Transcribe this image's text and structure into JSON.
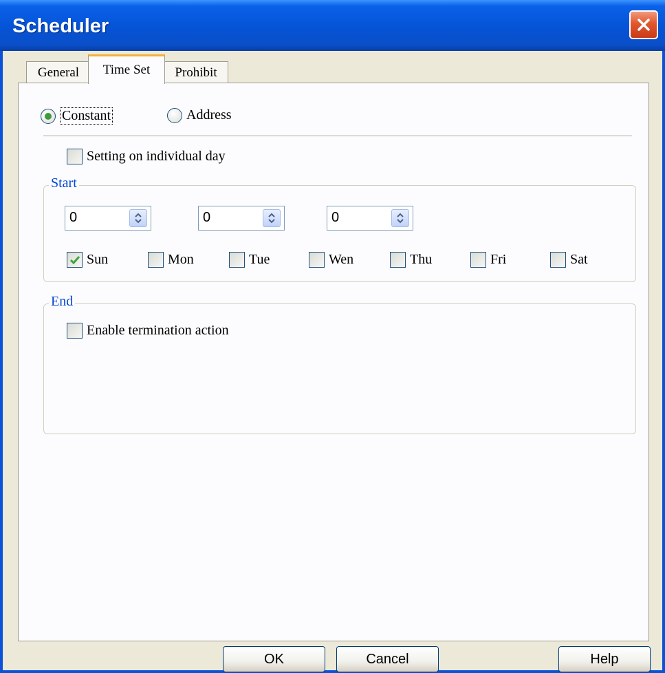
{
  "window": {
    "title": "Scheduler"
  },
  "tabs": [
    {
      "label": "General"
    },
    {
      "label": "Time Set"
    },
    {
      "label": "Prohibit"
    }
  ],
  "mode": {
    "constant_label": "Constant",
    "address_label": "Address",
    "selected": "Constant"
  },
  "individual_day": {
    "label": "Setting on individual day",
    "checked": false
  },
  "start": {
    "group_label": "Start",
    "spinners": [
      {
        "value": "0"
      },
      {
        "value": "0"
      },
      {
        "value": "0"
      }
    ],
    "days": [
      {
        "label": "Sun",
        "checked": true
      },
      {
        "label": "Mon",
        "checked": false
      },
      {
        "label": "Tue",
        "checked": false
      },
      {
        "label": "Wen",
        "checked": false
      },
      {
        "label": "Thu",
        "checked": false
      },
      {
        "label": "Fri",
        "checked": false
      },
      {
        "label": "Sat",
        "checked": false
      }
    ]
  },
  "end": {
    "group_label": "End",
    "termination": {
      "label": "Enable termination action",
      "checked": false
    }
  },
  "buttons": {
    "ok": "OK",
    "cancel": "Cancel",
    "help": "Help"
  },
  "colors": {
    "title_bar": "#0553d6",
    "group_label": "#0046d5",
    "check_mark": "#3da43d",
    "radio_dot": "#3d9a3d"
  }
}
